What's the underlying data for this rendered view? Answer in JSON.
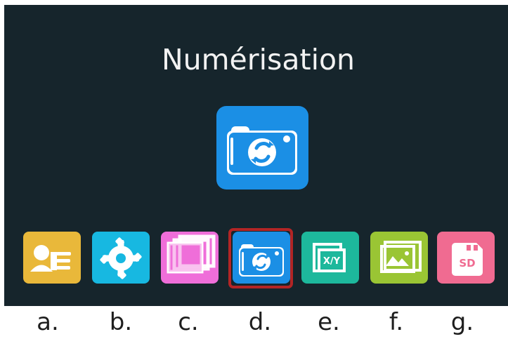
{
  "screen": {
    "title": "Numérisation",
    "background": "#16252c",
    "hero_icon": {
      "name": "scan-camera-icon",
      "color": "#1b8fe5"
    }
  },
  "menu": {
    "selected_index": 3,
    "selection_color": "#b32525",
    "items": [
      {
        "key": "contact",
        "icon": "contact-card-icon",
        "color": "#e9b83a"
      },
      {
        "key": "settings",
        "icon": "gear-icon",
        "color": "#17b8e1"
      },
      {
        "key": "layers",
        "icon": "stacked-frames-icon",
        "color": "#ef6ed9"
      },
      {
        "key": "scan",
        "icon": "scan-camera-icon",
        "color": "#1b8fe5"
      },
      {
        "key": "xy",
        "icon": "xy-frame-icon",
        "color": "#1db89c"
      },
      {
        "key": "gallery",
        "icon": "gallery-icon",
        "color": "#9ac534"
      },
      {
        "key": "sd",
        "icon": "sd-card-icon",
        "color": "#f06b91"
      }
    ]
  },
  "captions": [
    "a.",
    "b.",
    "c.",
    "d.",
    "e.",
    "f.",
    "g."
  ],
  "labels": {
    "xy": "X/Y",
    "sd": "SD"
  }
}
